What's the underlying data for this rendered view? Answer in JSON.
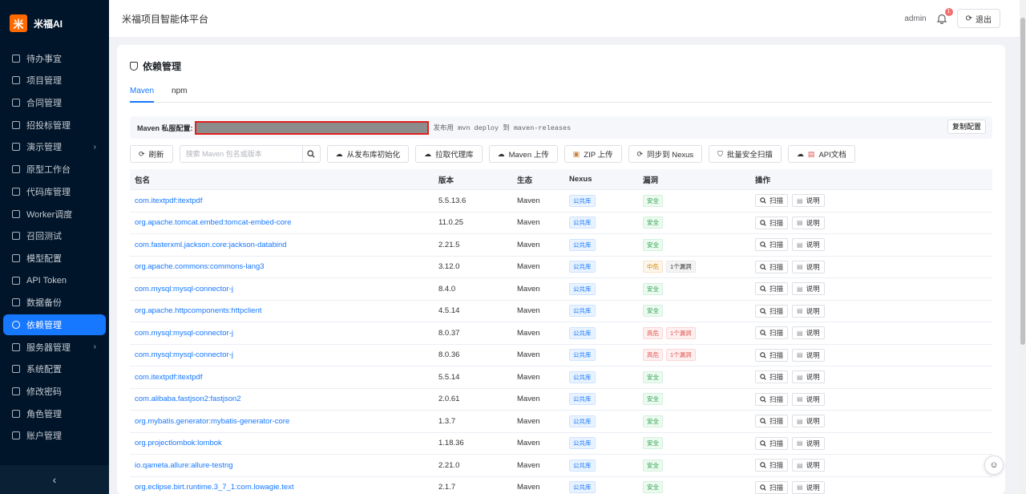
{
  "brand": {
    "logo": "米",
    "name": "米福AI"
  },
  "sidebar": {
    "items": [
      {
        "label": "待办事宜",
        "icon": "checkbox-icon"
      },
      {
        "label": "项目管理",
        "icon": "project-icon"
      },
      {
        "label": "合同管理",
        "icon": "contract-icon"
      },
      {
        "label": "招投标管理",
        "icon": "bid-icon"
      },
      {
        "label": "演示管理",
        "icon": "play-icon",
        "arrow": "›"
      },
      {
        "label": "原型工作台",
        "icon": "prototype-icon"
      },
      {
        "label": "代码库管理",
        "icon": "code-icon"
      },
      {
        "label": "Worker调度",
        "icon": "lightning-icon"
      },
      {
        "label": "召回测试",
        "icon": "search-icon"
      },
      {
        "label": "模型配置",
        "icon": "gear-icon"
      },
      {
        "label": "API Token",
        "icon": "key-icon"
      },
      {
        "label": "数据备份",
        "icon": "database-icon"
      },
      {
        "label": "依赖管理",
        "icon": "shield-icon",
        "active": true
      },
      {
        "label": "服务器管理",
        "icon": "server-icon",
        "arrow": "›"
      },
      {
        "label": "系统配置",
        "icon": "folder-icon"
      },
      {
        "label": "修改密码",
        "icon": "lock-icon"
      },
      {
        "label": "角色管理",
        "icon": "role-icon"
      },
      {
        "label": "账户管理",
        "icon": "user-icon"
      }
    ],
    "collapse": "‹"
  },
  "header": {
    "title": "米福项目智能体平台",
    "user": "admin",
    "notification_count": "1",
    "logout": "退出"
  },
  "page": {
    "title": "依赖管理",
    "tabs": [
      {
        "label": "Maven",
        "active": true
      },
      {
        "label": "npm"
      }
    ],
    "config": {
      "label": "Maven 私服配置:",
      "hint": "发布用 mvn deploy 到 maven-releases",
      "copy": "复制配置"
    },
    "toolbar": {
      "refresh": "刷新",
      "search_placeholder": "搜索 Maven 包名或版本",
      "init": "从发布库初始化",
      "pull": "拉取代理库",
      "upload": "Maven 上传",
      "zip": "ZIP 上传",
      "sync": "同步到 Nexus",
      "scan_all": "批量安全扫描",
      "api_doc": "API文档"
    },
    "table": {
      "headers": [
        "包名",
        "版本",
        "生态",
        "Nexus",
        "漏洞",
        "操作"
      ],
      "scan_label": "扫描",
      "doc_label": "说明",
      "rows": [
        {
          "name": "com.itextpdf:itextpdf",
          "version": "5.5.13.6",
          "eco": "Maven",
          "nexus": "公共库",
          "vul": "安全",
          "level": "safe",
          "count": ""
        },
        {
          "name": "org.apache.tomcat.embed:tomcat-embed-core",
          "version": "11.0.25",
          "eco": "Maven",
          "nexus": "公共库",
          "vul": "安全",
          "level": "safe",
          "count": ""
        },
        {
          "name": "com.fasterxml.jackson.core:jackson-databind",
          "version": "2.21.5",
          "eco": "Maven",
          "nexus": "公共库",
          "vul": "安全",
          "level": "safe",
          "count": ""
        },
        {
          "name": "org.apache.commons:commons-lang3",
          "version": "3.12.0",
          "eco": "Maven",
          "nexus": "公共库",
          "vul": "中危",
          "level": "mid",
          "count": "1个漏洞"
        },
        {
          "name": "com.mysql:mysql-connector-j",
          "version": "8.4.0",
          "eco": "Maven",
          "nexus": "公共库",
          "vul": "安全",
          "level": "safe",
          "count": ""
        },
        {
          "name": "org.apache.httpcomponents:httpclient",
          "version": "4.5.14",
          "eco": "Maven",
          "nexus": "公共库",
          "vul": "安全",
          "level": "safe",
          "count": ""
        },
        {
          "name": "com.mysql:mysql-connector-j",
          "version": "8.0.37",
          "eco": "Maven",
          "nexus": "公共库",
          "vul": "高危",
          "level": "high",
          "count": "1个漏洞"
        },
        {
          "name": "com.mysql:mysql-connector-j",
          "version": "8.0.36",
          "eco": "Maven",
          "nexus": "公共库",
          "vul": "高危",
          "level": "high",
          "count": "1个漏洞"
        },
        {
          "name": "com.itextpdf:itextpdf",
          "version": "5.5.14",
          "eco": "Maven",
          "nexus": "公共库",
          "vul": "安全",
          "level": "safe",
          "count": ""
        },
        {
          "name": "com.alibaba.fastjson2:fastjson2",
          "version": "2.0.61",
          "eco": "Maven",
          "nexus": "公共库",
          "vul": "安全",
          "level": "safe",
          "count": ""
        },
        {
          "name": "org.mybatis.generator:mybatis-generator-core",
          "version": "1.3.7",
          "eco": "Maven",
          "nexus": "公共库",
          "vul": "安全",
          "level": "safe",
          "count": ""
        },
        {
          "name": "org.projectlombok:lombok",
          "version": "1.18.36",
          "eco": "Maven",
          "nexus": "公共库",
          "vul": "安全",
          "level": "safe",
          "count": ""
        },
        {
          "name": "io.qameta.allure:allure-testng",
          "version": "2.21.0",
          "eco": "Maven",
          "nexus": "公共库",
          "vul": "安全",
          "level": "safe",
          "count": ""
        },
        {
          "name": "org.eclipse.birt.runtime.3_7_1:com.lowagie.text",
          "version": "2.1.7",
          "eco": "Maven",
          "nexus": "公共库",
          "vul": "安全",
          "level": "safe",
          "count": ""
        }
      ]
    }
  }
}
